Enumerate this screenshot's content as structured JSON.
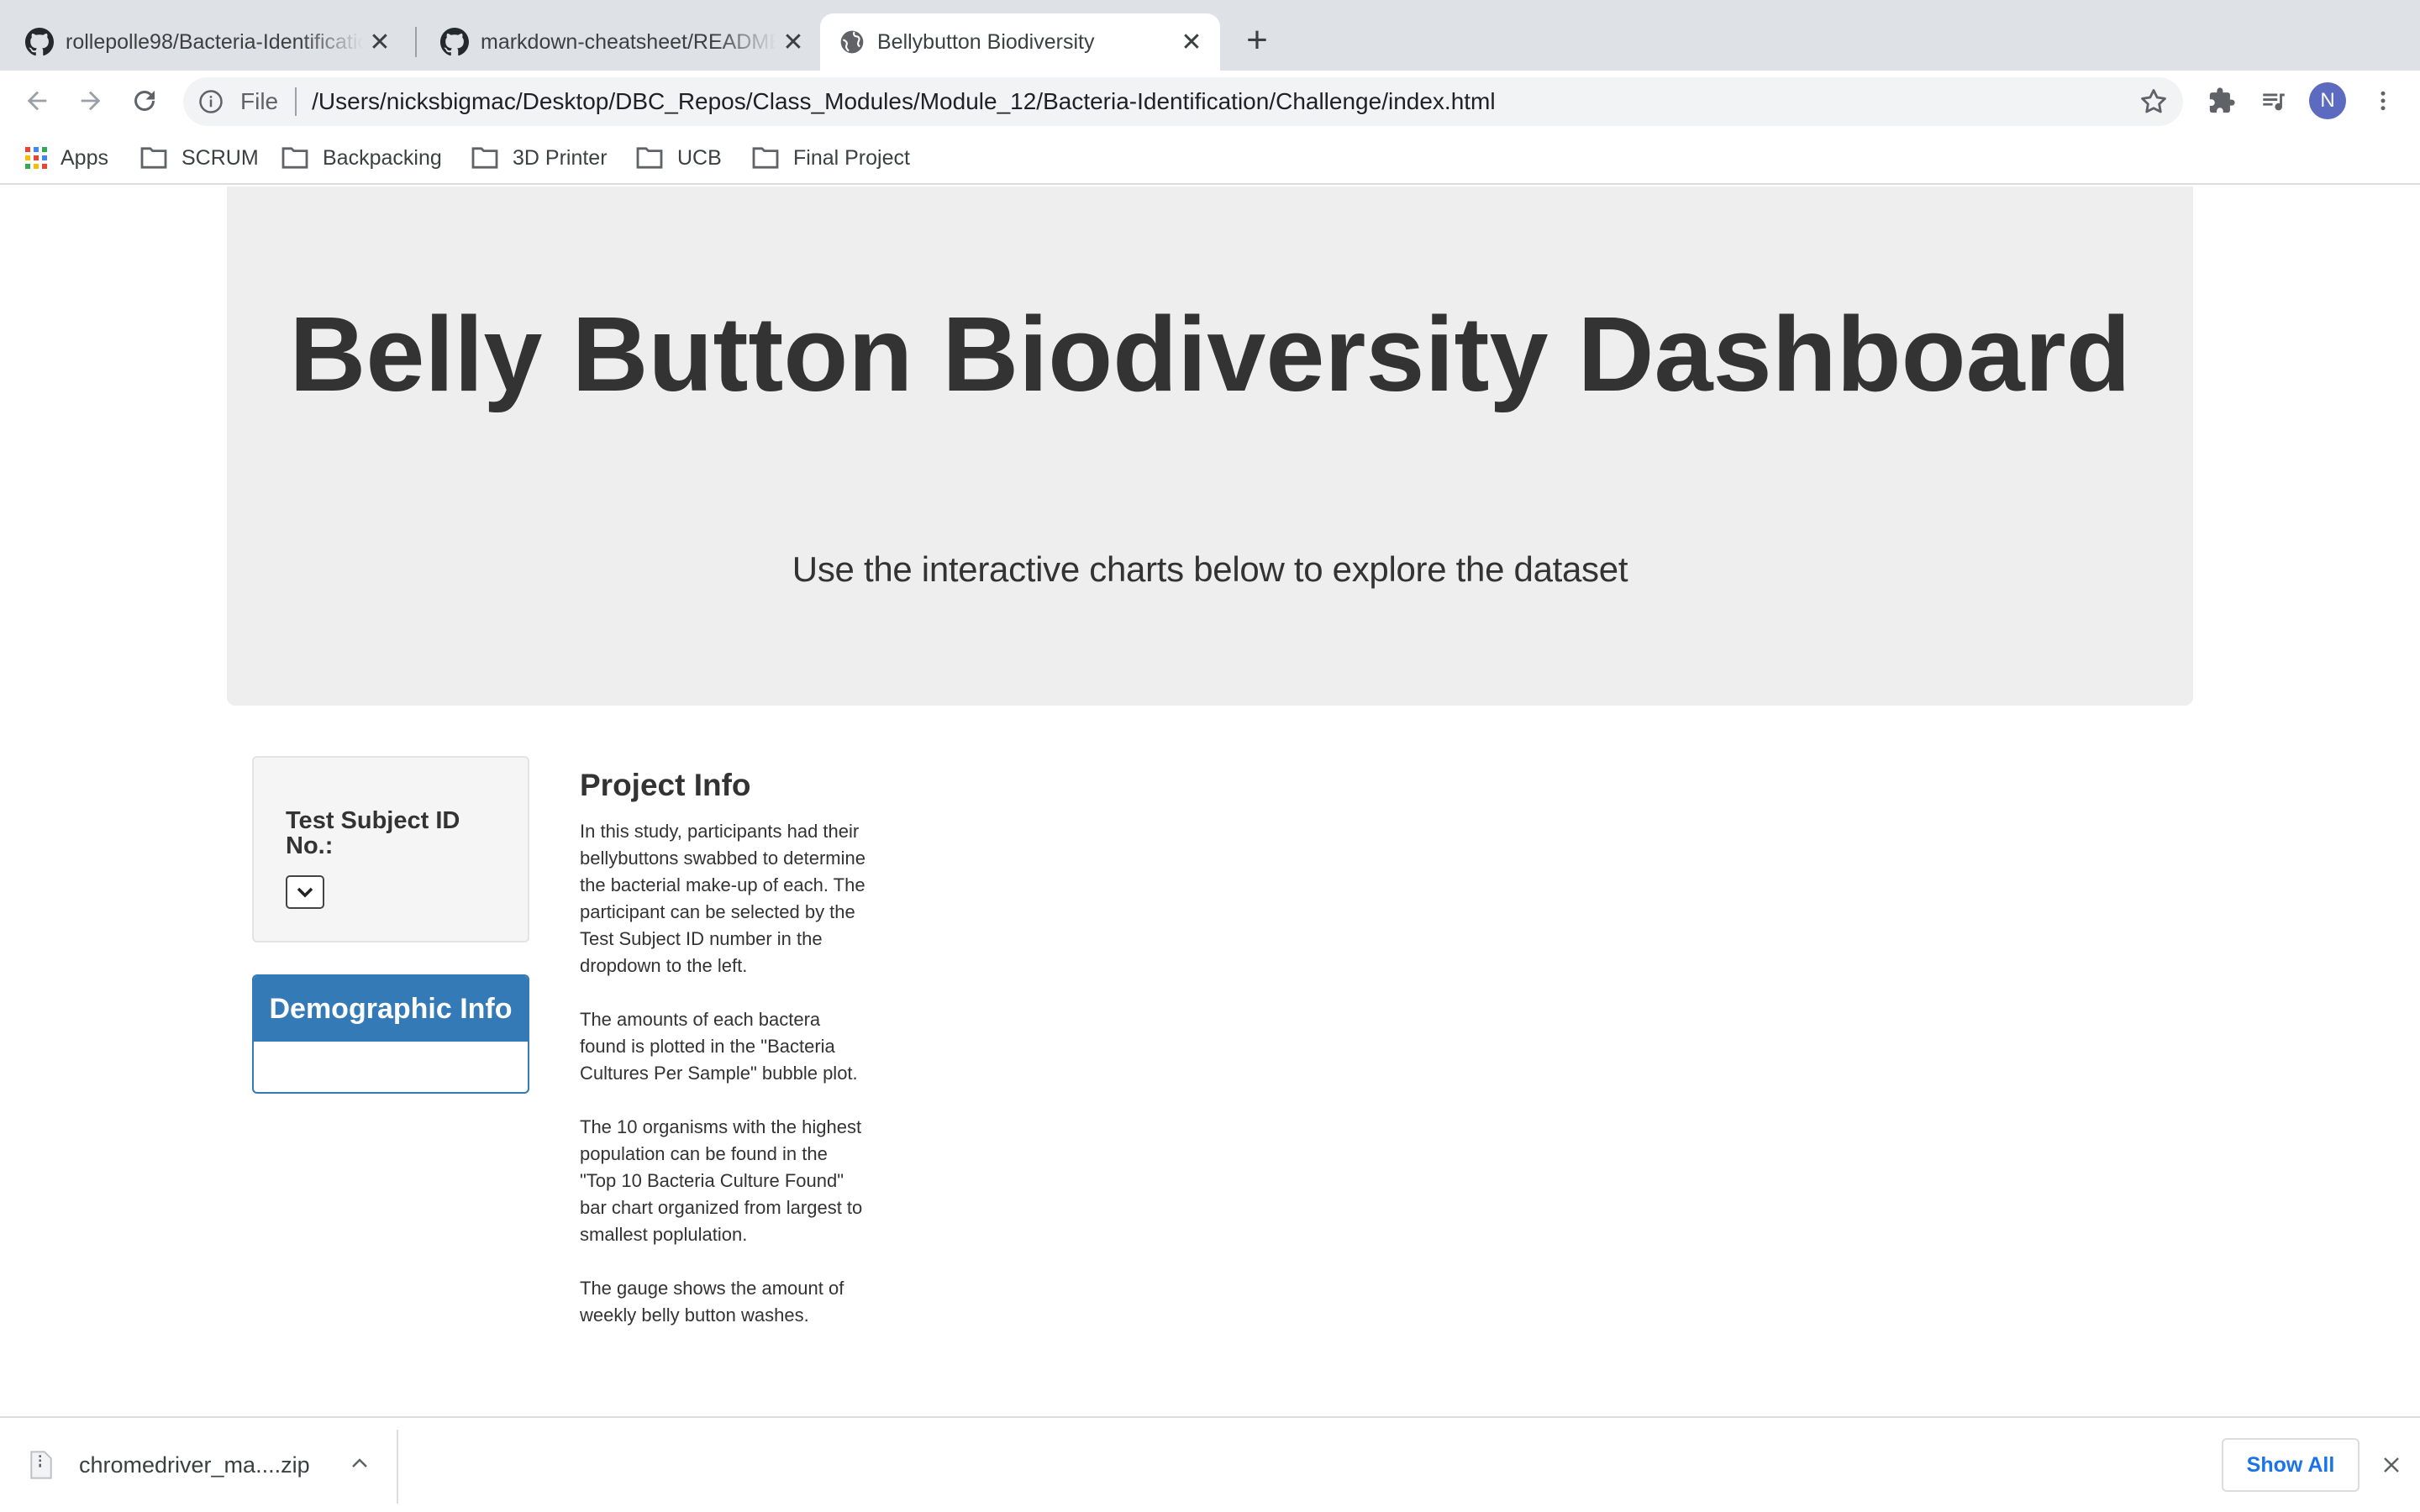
{
  "browser": {
    "tabs": [
      {
        "title": "rollepolle98/Bacteria-Identification",
        "icon": "github-icon"
      },
      {
        "title": "markdown-cheatsheet/README.md",
        "icon": "github-icon"
      },
      {
        "title": "Bellybutton Biodiversity",
        "icon": "globe-icon",
        "active": true
      }
    ],
    "omnibox": {
      "scheme": "File",
      "url": "/Users/nicksbigmac/Desktop/DBC_Repos/Class_Modules/Module_12/Bacteria-Identification/Challenge/index.html"
    },
    "profile_initial": "N",
    "bookmarks": [
      {
        "label": "Apps",
        "icon": "apps-grid-icon"
      },
      {
        "label": "SCRUM",
        "icon": "folder-icon"
      },
      {
        "label": "Backpacking",
        "icon": "folder-icon"
      },
      {
        "label": "3D Printer",
        "icon": "folder-icon"
      },
      {
        "label": "UCB",
        "icon": "folder-icon"
      },
      {
        "label": "Final Project",
        "icon": "folder-icon"
      }
    ]
  },
  "page": {
    "title": "Belly Button Biodiversity Dashboard",
    "subtitle": "Use the interactive charts below to explore the dataset",
    "selector_label": "Test Subject ID No.:",
    "demographic_title": "Demographic Info",
    "project_info": {
      "title": "Project Info",
      "paragraphs": [
        "In this study, participants had their bellybuttons swabbed to determine the bacterial make-up of each. The participant can be selected by the Test Subject ID number in the dropdown to the left.",
        "The amounts of each bactera found is plotted in the \"Bacteria Cultures Per Sample\" bubble plot.",
        "The 10 organisms with the highest population can be found in the \"Top 10 Bacteria Culture Found\" bar chart organized from largest to smallest poplulation.",
        "The gauge shows the amount of weekly belly button washes."
      ]
    }
  },
  "downloads": {
    "file_name": "chromedriver_ma....zip",
    "show_all_label": "Show All"
  },
  "colors": {
    "tabstrip": "#dee1e6",
    "jumbotron": "#eeeeee",
    "panel_primary": "#337ab7",
    "link_blue": "#1a73e8",
    "avatar": "#5c6bc0"
  }
}
